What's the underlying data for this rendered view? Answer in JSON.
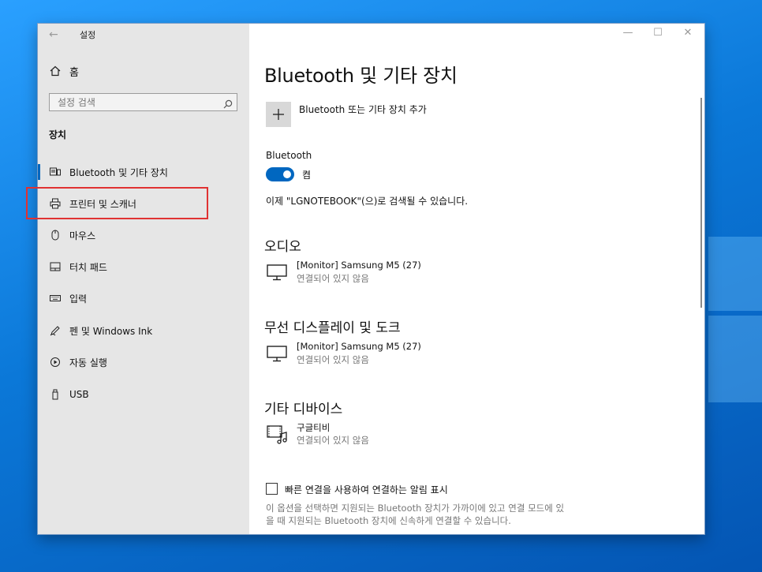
{
  "app": {
    "title": "설정",
    "back": "←"
  },
  "window_controls": {
    "minimize": "—",
    "maximize": "☐",
    "close": "✕"
  },
  "sidebar": {
    "home_label": "홈",
    "search_placeholder": "설정 검색",
    "section_title": "장치",
    "items": [
      {
        "label": "Bluetooth 및 기타 장치",
        "icon": "bluetooth-devices-icon",
        "active": true
      },
      {
        "label": "프린터 및 스캐너",
        "icon": "printer-icon",
        "highlighted": true
      },
      {
        "label": "마우스",
        "icon": "mouse-icon"
      },
      {
        "label": "터치 패드",
        "icon": "touchpad-icon"
      },
      {
        "label": "입력",
        "icon": "keyboard-icon"
      },
      {
        "label": "펜 및 Windows Ink",
        "icon": "pen-icon"
      },
      {
        "label": "자동 실행",
        "icon": "autoplay-icon"
      },
      {
        "label": "USB",
        "icon": "usb-icon"
      }
    ]
  },
  "main": {
    "title": "Bluetooth 및 기타 장치",
    "add_device_label": "Bluetooth 또는 기타 장치 추가",
    "bluetooth_label": "Bluetooth",
    "bluetooth_state": "켬",
    "discoverable_text": "이제 \"LGNOTEBOOK\"(으)로 검색될 수 있습니다.",
    "audio": {
      "heading": "오디오",
      "devices": [
        {
          "name": "[Monitor] Samsung M5 (27)",
          "status": "연결되어 있지 않음",
          "icon": "monitor-icon"
        }
      ]
    },
    "wireless": {
      "heading": "무선 디스플레이 및 도크",
      "devices": [
        {
          "name": "[Monitor] Samsung M5 (27)",
          "status": "연결되어 있지 않음",
          "icon": "monitor-icon"
        }
      ]
    },
    "other": {
      "heading": "기타 디바이스",
      "devices": [
        {
          "name": "구글티비",
          "status": "연결되어 있지 않음",
          "icon": "media-device-icon"
        }
      ]
    },
    "swift_pair_label": "빠른 연결을 사용하여 연결하는 알림 표시",
    "swift_pair_desc": "이 옵션을 선택하면 지원되는 Bluetooth 장치가 가까이에 있고 연결 모드에 있을 때 지원되는 Bluetooth 장치에 신속하게 연결할 수 있습니다."
  },
  "colors": {
    "accent": "#0067c0",
    "highlight_box": "#e03232",
    "sidebar_bg": "#e6e6e6"
  }
}
